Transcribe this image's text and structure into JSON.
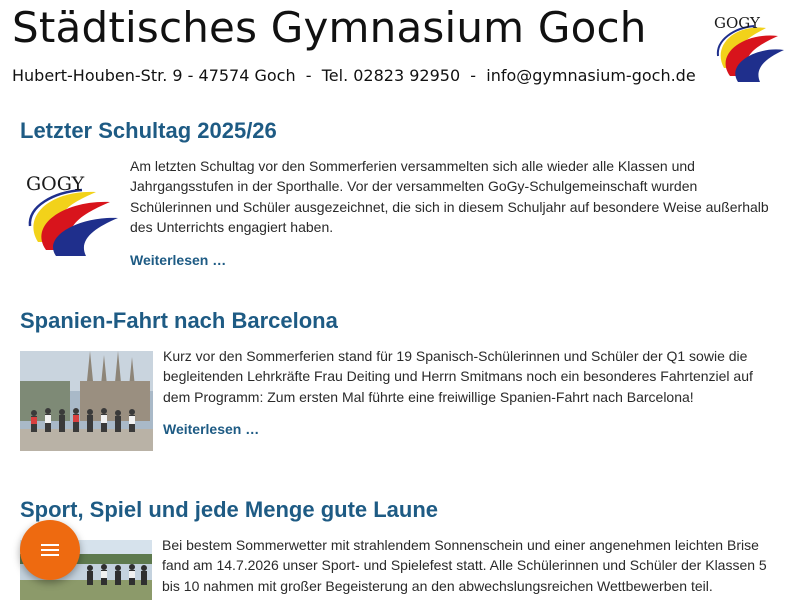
{
  "header": {
    "title": "Städtisches Gymnasium Goch",
    "contact": "Hubert-Houben-Str. 9 - 47574 Goch  -  Tel. 02823 92950  -  info@gymnasium-goch.de",
    "logo_text": "GOGY"
  },
  "posts": [
    {
      "title": "Letzter Schultag 2025/26",
      "logo_text": "GOGY",
      "text": "Am letzten Schultag vor den Sommerferien versammelten sich alle wieder alle Klassen und Jahrgangsstufen in der Sporthalle. Vor der versammelten GoGy-Schulgemeinschaft wurden Schülerinnen und Schüler ausgezeichnet, die sich in diesem Schuljahr auf besondere Weise außerhalb des Unterrichts engagiert haben.",
      "read_more": "Weiterlesen …"
    },
    {
      "title": "Spanien-Fahrt nach Barcelona",
      "text": "Kurz vor den Sommerferien stand für 19 Spanisch-Schülerinnen und Schüler der Q1 sowie die begleitenden Lehrkräfte Frau Deiting und Herrn Smitmans noch ein besonderes Fahrtenziel auf dem Programm: Zum ersten Mal führte eine freiwillige Spanien-Fahrt nach Barcelona!",
      "read_more": "Weiterlesen …"
    },
    {
      "title": "Sport, Spiel und jede Menge gute Laune",
      "text": "Bei bestem Sommerwetter mit strahlendem Sonnenschein und einer angenehmen leichten Brise fand am 14.7.2026 unser Sport- und Spielefest statt. Alle Schülerinnen und Schüler der Klassen 5 bis 10 nahmen mit großer Begeisterung an den abwechslungsreichen Wettbewerben teil."
    }
  ],
  "colors": {
    "heading": "#1e5b84",
    "fab": "#ee6a10",
    "logo_yellow": "#f2d21a",
    "logo_red": "#d8141c",
    "logo_blue": "#1f2f8c"
  },
  "icons": {
    "fab": "menu-icon"
  }
}
